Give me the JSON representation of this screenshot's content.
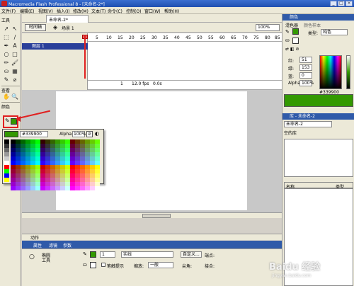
{
  "window": {
    "title": "Macromedia Flash Professional 8 - [未命名-2*]",
    "buttons": [
      "_",
      "□",
      "×"
    ]
  },
  "menu": [
    "文件(F)",
    "编辑(E)",
    "视图(V)",
    "插入(I)",
    "修改(M)",
    "文本(T)",
    "命令(C)",
    "控制(O)",
    "窗口(W)",
    "帮助(H)"
  ],
  "tools": {
    "header": "工具",
    "view_header": "查看",
    "colors_header": "颜色",
    "glyphs": [
      "➚",
      "↖",
      "⬚",
      "∕",
      "✒",
      "A",
      "○",
      "□",
      "✏",
      "🖌",
      "⛀",
      "▦",
      "✎",
      "⌀",
      "✋",
      "🔍"
    ]
  },
  "document": {
    "tab": "未命名-2*",
    "timeline_button": "时间轴",
    "scene": "场景 1",
    "zoom": "100%"
  },
  "timeline": {
    "layer": "图层 1",
    "ruler": [
      "5",
      "10",
      "15",
      "20",
      "25",
      "30",
      "35",
      "40",
      "45",
      "50",
      "55",
      "60",
      "65",
      "70",
      "75",
      "80",
      "85"
    ],
    "frame": "1",
    "fps": "12.0 fps",
    "time": "0.0s"
  },
  "swatch_popup": {
    "hex": "#339900",
    "alpha_label": "Alpha:",
    "alpha_value": "100%"
  },
  "panels": {
    "actions": "动作",
    "props_tabs": [
      "属性",
      "滤镜",
      "参数"
    ],
    "props": {
      "tool_name": "椭圆\n工具",
      "stroke_size": "1",
      "stroke_style": "实线",
      "custom": "自定义...",
      "endcap": "端点:",
      "smooth": "笔触提示",
      "scale": "缩放:",
      "scale_value": "一般",
      "tip": "尖角:",
      "join": "接合:"
    }
  },
  "color_panel": {
    "title": "颜色",
    "tabs": [
      "混色器",
      "颜色样本"
    ],
    "type_label": "类型:",
    "type_value": "纯色",
    "r_label": "红:",
    "r_value": "51",
    "g_label": "绿:",
    "g_value": "153",
    "b_label": "蓝:",
    "b_value": "0",
    "alpha_label": "Alpha:",
    "alpha_value": "100%",
    "hex": "#339900",
    "current_color": "#339900"
  },
  "library_panel": {
    "title": "库 - 未命名-2",
    "doc_select": "未命名-2",
    "empty_text": "空的库",
    "col_name": "名称",
    "col_type": "类型"
  },
  "watermark": {
    "text": "Baidu 经验",
    "sub": "jingyan.baidu.com"
  }
}
